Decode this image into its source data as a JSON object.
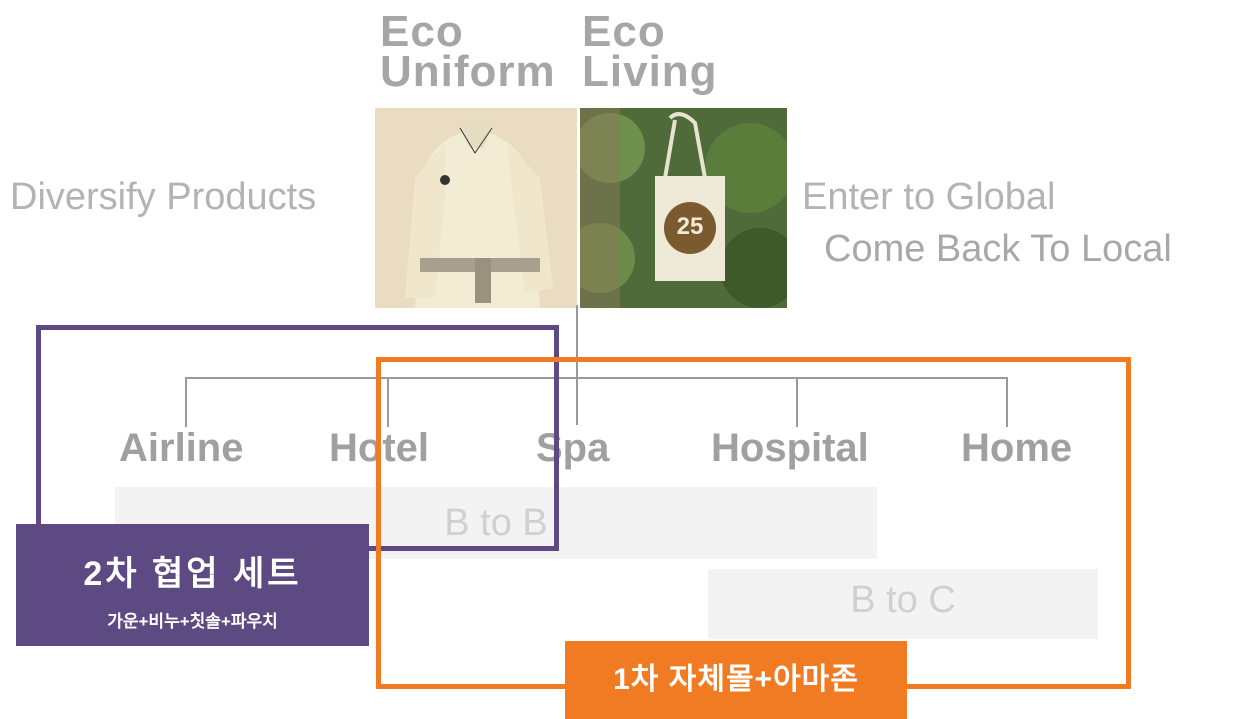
{
  "products": {
    "uniform": {
      "line1": "Eco",
      "line2": "Uniform"
    },
    "living": {
      "line1": "Eco",
      "line2": "Living",
      "bag_number": "25"
    }
  },
  "strategies": {
    "left": "Diversify Products",
    "right_line1": "Enter to Global",
    "right_line2": "Come Back To Local"
  },
  "markets": {
    "categories": [
      "Airline",
      "Hotel",
      "Spa",
      "Hospital",
      "Home"
    ],
    "b2b": "B to B",
    "b2c": "B to C"
  },
  "boxes": {
    "purple": {
      "title": "2차 협업 세트",
      "subtitle": "가운+비누+칫솔+파우치",
      "color": "#5e4a82"
    },
    "orange": {
      "title": "1차 자체몰+아마존",
      "color": "#f07b22"
    }
  }
}
